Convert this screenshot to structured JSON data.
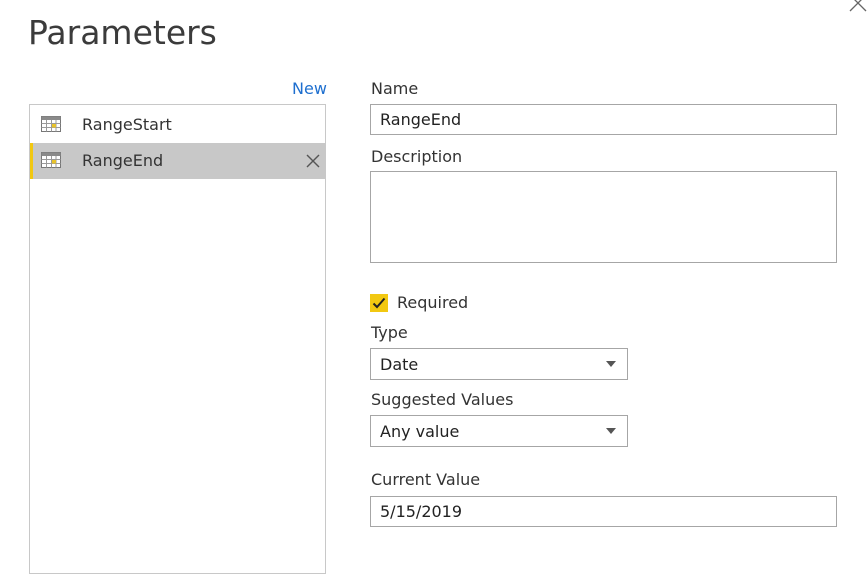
{
  "dialog": {
    "title": "Parameters"
  },
  "list": {
    "new_label": "New",
    "items": [
      {
        "label": "RangeStart",
        "selected": false
      },
      {
        "label": "RangeEnd",
        "selected": true
      }
    ]
  },
  "form": {
    "name_label": "Name",
    "name_value": "RangeEnd",
    "description_label": "Description",
    "description_value": "",
    "required_label": "Required",
    "required_checked": true,
    "type_label": "Type",
    "type_value": "Date",
    "suggested_label": "Suggested Values",
    "suggested_value": "Any value",
    "current_label": "Current Value",
    "current_value": "5/15/2019"
  },
  "colors": {
    "accent": "#f2c811",
    "link": "#1e6fcf",
    "selected_bg": "#c8c8c8"
  },
  "icons": {
    "close": "close-icon",
    "table": "table-icon",
    "delete": "delete-icon",
    "check": "checkmark-icon",
    "dropdown": "chevron-down-icon"
  }
}
